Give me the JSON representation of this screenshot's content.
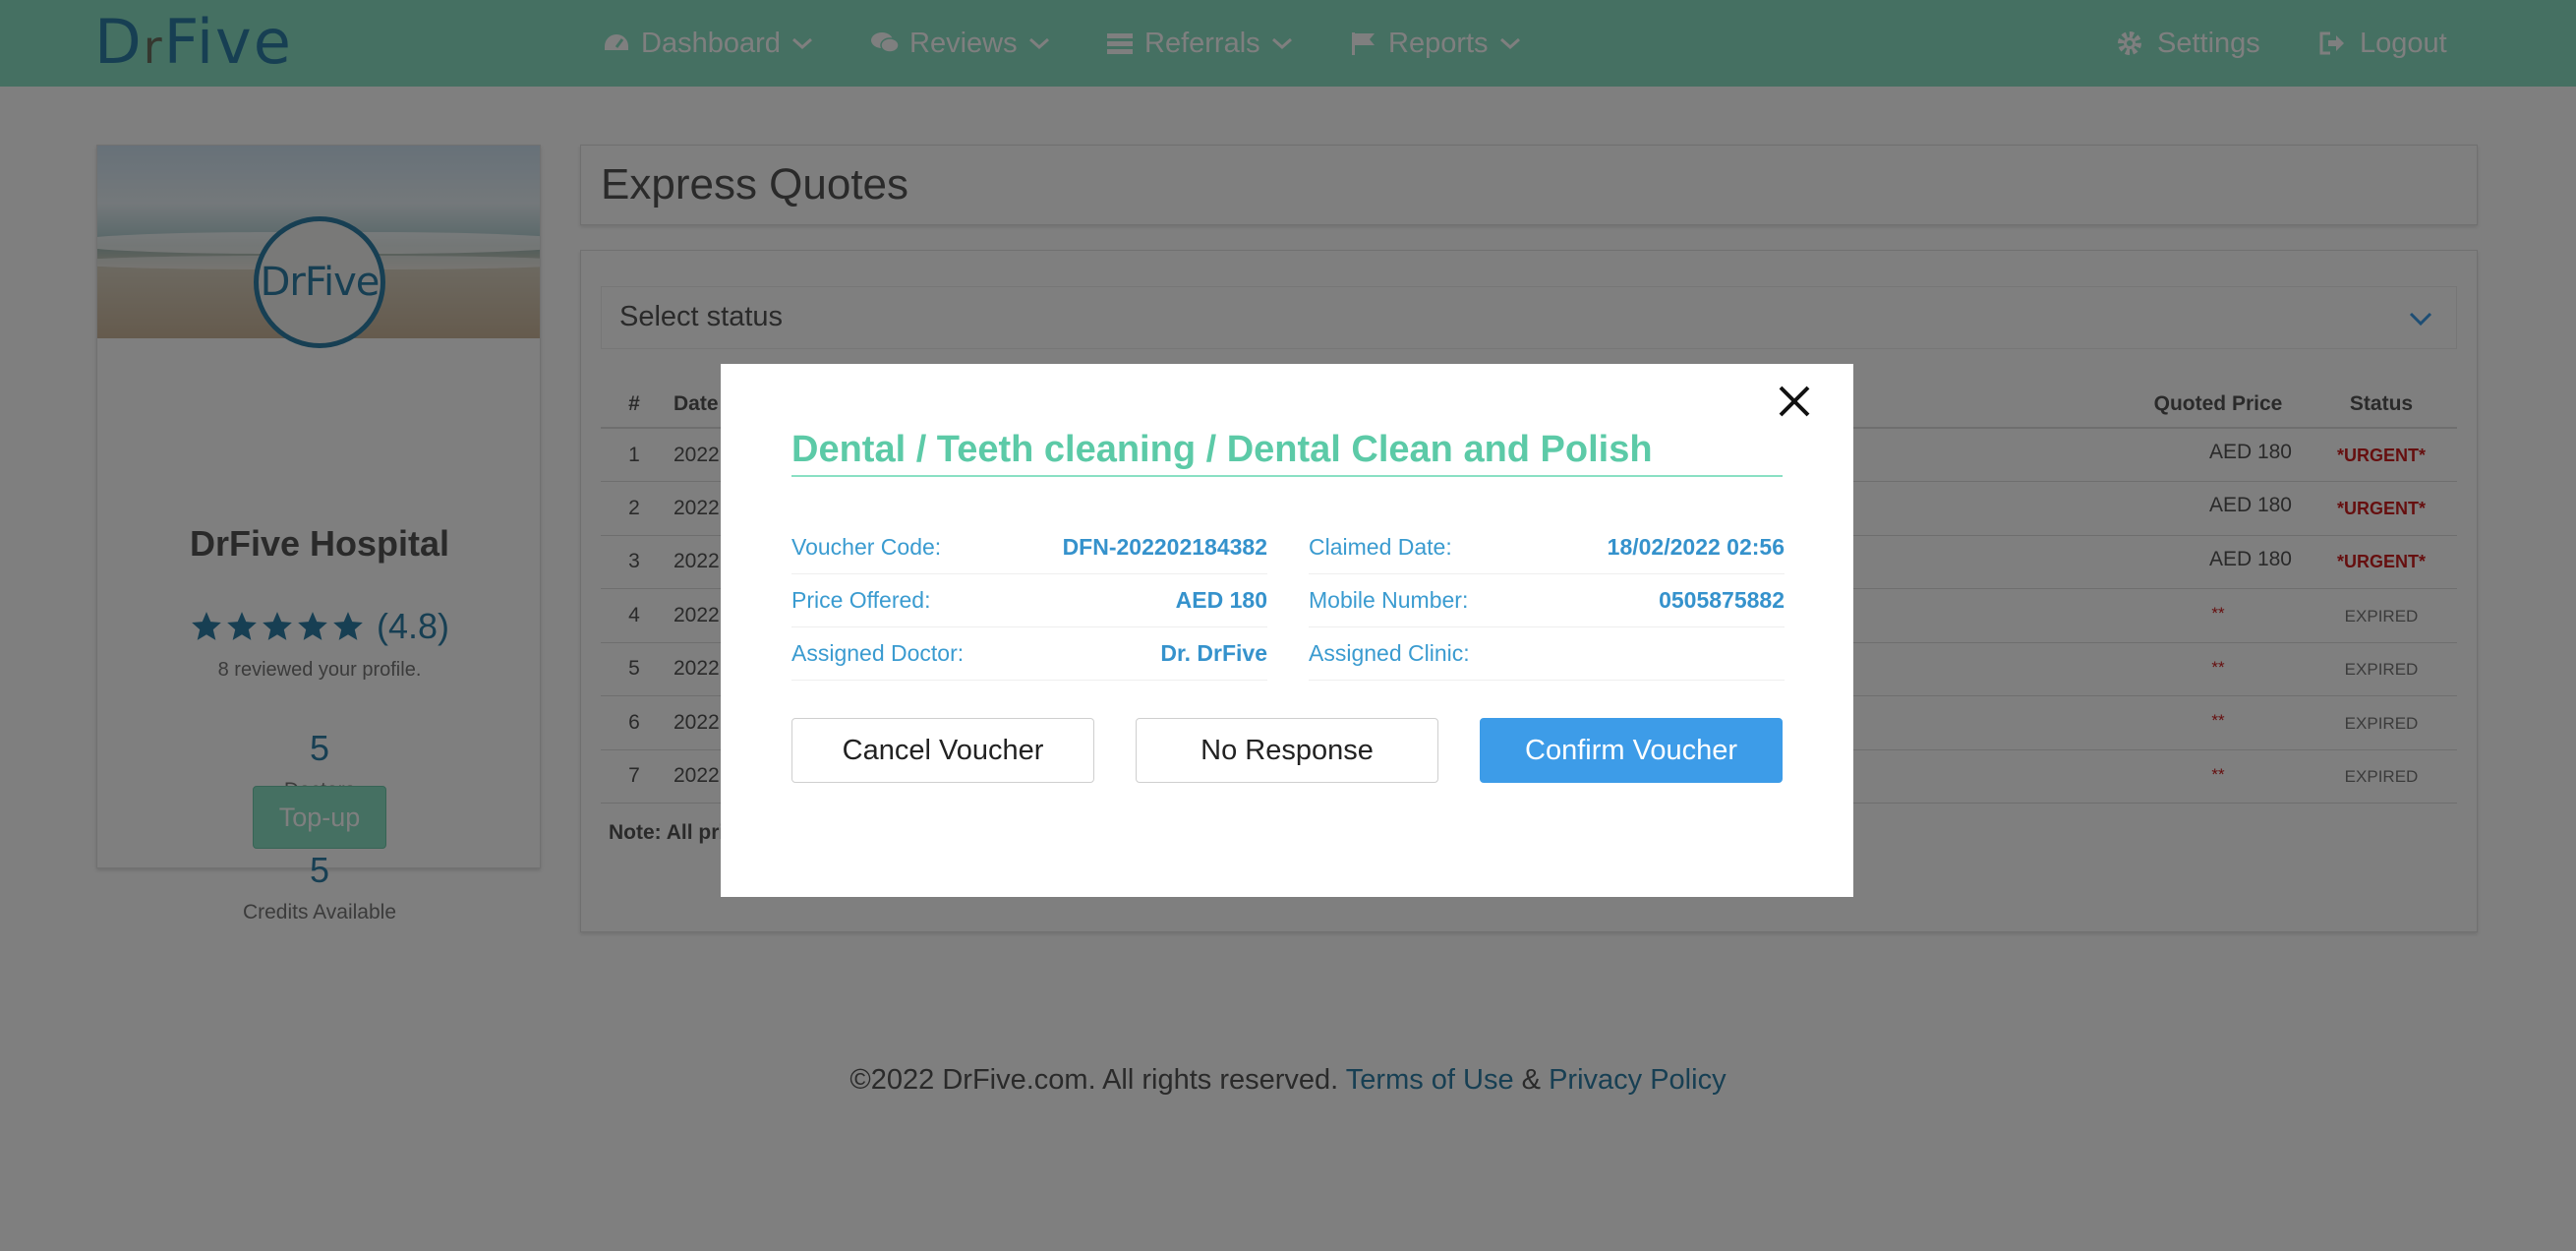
{
  "nav": {
    "logo_d": "D",
    "logo_r": "r",
    "logo_rest": "Five",
    "items": [
      {
        "label": "Dashboard",
        "icon": "dashboard-icon"
      },
      {
        "label": "Reviews",
        "icon": "comments-icon"
      },
      {
        "label": "Referrals",
        "icon": "referrals-icon"
      },
      {
        "label": "Reports",
        "icon": "flag-icon"
      }
    ],
    "settings_label": "Settings",
    "logout_label": "Logout"
  },
  "profile": {
    "avatar_text": "DrFive",
    "name": "DrFive Hospital",
    "rating": "(4.8)",
    "stars": 5,
    "reviewed_text": "8 reviewed your profile.",
    "doctors_count": "5",
    "doctors_label": "Doctors",
    "credits_count": "5",
    "credits_label": "Credits Available",
    "topup_label": "Top-up"
  },
  "express_quotes": {
    "title": "Express Quotes",
    "status_placeholder": "Select status",
    "columns": {
      "num": "#",
      "date": "Date",
      "quoted_price": "Quoted Price",
      "status": "Status"
    },
    "rows": [
      {
        "num": "1",
        "date": "2022",
        "price": "AED 180",
        "status": "*URGENT*",
        "type": "urgent"
      },
      {
        "num": "2",
        "date": "2022",
        "price": "AED 180",
        "status": "*URGENT*",
        "type": "urgent"
      },
      {
        "num": "3",
        "date": "2022",
        "price": "AED 180",
        "status": "*URGENT*",
        "type": "urgent"
      },
      {
        "num": "4",
        "date": "2022",
        "price": "**",
        "status": "EXPIRED",
        "type": "expired"
      },
      {
        "num": "5",
        "date": "2022",
        "price": "**",
        "status": "EXPIRED",
        "type": "expired"
      },
      {
        "num": "6",
        "date": "2022",
        "price": "**",
        "status": "EXPIRED",
        "type": "expired"
      },
      {
        "num": "7",
        "date": "2022",
        "price": "**",
        "status": "EXPIRED",
        "type": "expired"
      }
    ],
    "note": "Note: All pri"
  },
  "footer": {
    "copyright": "©2022 DrFive.com. All rights reserved.",
    "terms": "Terms of Use",
    "amp": "&",
    "privacy": "Privacy Policy"
  },
  "modal": {
    "title": "Dental / Teeth cleaning / Dental Clean and Polish",
    "fields": {
      "voucher_code_label": "Voucher Code:",
      "voucher_code": "DFN-202202184382",
      "price_offered_label": "Price Offered:",
      "price_offered": "AED 180",
      "assigned_doctor_label": "Assigned Doctor:",
      "assigned_doctor": "Dr. DrFive",
      "claimed_date_label": "Claimed Date:",
      "claimed_date": "18/02/2022 02:56",
      "mobile_label": "Mobile Number:",
      "mobile": "0505875882",
      "assigned_clinic_label": "Assigned Clinic:",
      "assigned_clinic": ""
    },
    "cancel_label": "Cancel Voucher",
    "no_response_label": "No Response",
    "confirm_label": "Confirm Voucher"
  },
  "colors": {
    "brand_mint": "#8ae0c4",
    "brand_blue": "#2f7fa6",
    "primary_button": "#3d9ce8",
    "urgent_red": "#cc1f1f"
  }
}
